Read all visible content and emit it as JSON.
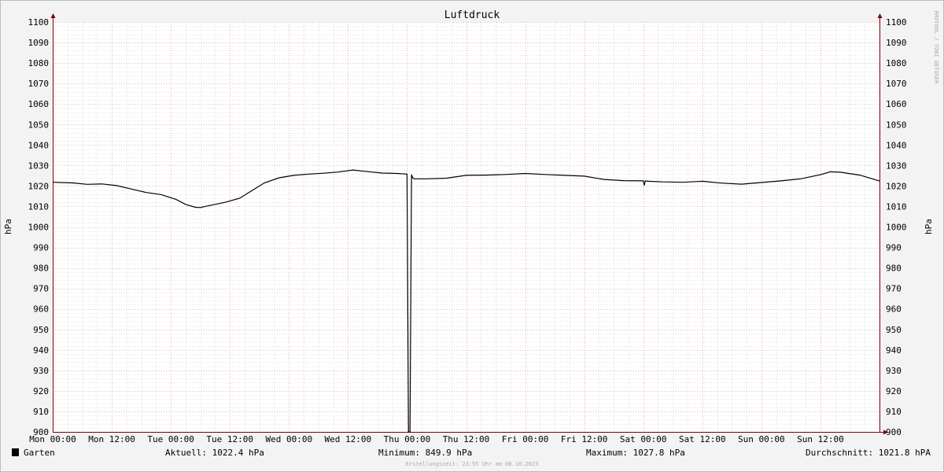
{
  "chart_data": {
    "type": "line",
    "title": "Luftdruck",
    "ylabel": "hPa",
    "ylabel_right": "hPa",
    "ylim": [
      900,
      1100
    ],
    "yticks": [
      900,
      910,
      920,
      930,
      940,
      950,
      960,
      970,
      980,
      990,
      1000,
      1010,
      1020,
      1030,
      1040,
      1050,
      1060,
      1070,
      1080,
      1090,
      1100
    ],
    "xlim_hours": [
      0,
      168
    ],
    "xticks": [
      {
        "hour": 0,
        "label": "Mon 00:00"
      },
      {
        "hour": 12,
        "label": "Mon 12:00"
      },
      {
        "hour": 24,
        "label": "Tue 00:00"
      },
      {
        "hour": 36,
        "label": "Tue 12:00"
      },
      {
        "hour": 48,
        "label": "Wed 00:00"
      },
      {
        "hour": 60,
        "label": "Wed 12:00"
      },
      {
        "hour": 72,
        "label": "Thu 00:00"
      },
      {
        "hour": 84,
        "label": "Thu 12:00"
      },
      {
        "hour": 96,
        "label": "Fri 00:00"
      },
      {
        "hour": 108,
        "label": "Fri 12:00"
      },
      {
        "hour": 120,
        "label": "Sat 00:00"
      },
      {
        "hour": 132,
        "label": "Sat 12:00"
      },
      {
        "hour": 144,
        "label": "Sun 00:00"
      },
      {
        "hour": 156,
        "label": "Sun 12:00"
      }
    ],
    "series": [
      {
        "name": "Garten",
        "color": "#000000",
        "hours": [
          0,
          4,
          7,
          10,
          13,
          16,
          19,
          22,
          25,
          27,
          29,
          30,
          32,
          35,
          38,
          41,
          43,
          46,
          49,
          52,
          55,
          58,
          61,
          64,
          67,
          70,
          72,
          72.3,
          72.6,
          72.9,
          73.2,
          73.5,
          76,
          80,
          84,
          88,
          92,
          96,
          100,
          104,
          108,
          112,
          116,
          120,
          120.2,
          120.4,
          120.6,
          121,
          124,
          128,
          132,
          136,
          140,
          144,
          148,
          152,
          156,
          158,
          160,
          164,
          168
        ],
        "values": [
          1021.8,
          1021.5,
          1020.8,
          1021,
          1020.2,
          1018.5,
          1016.8,
          1015.8,
          1013.5,
          1011,
          1009.6,
          1009.5,
          1010.5,
          1012,
          1014,
          1018.5,
          1021.5,
          1024,
          1025.2,
          1025.8,
          1026.2,
          1026.8,
          1027.8,
          1027,
          1026.3,
          1026.1,
          1025.8,
          849.9,
          849.9,
          1025.5,
          1023.8,
          1023.5,
          1023.5,
          1023.8,
          1025.2,
          1025.3,
          1025.6,
          1026.1,
          1025.6,
          1025.2,
          1024.8,
          1023.2,
          1022.6,
          1022.5,
          1020.3,
          1022.5,
          1022.4,
          1022.3,
          1022.0,
          1021.8,
          1022.3,
          1021.4,
          1020.9,
          1021.7,
          1022.5,
          1023.5,
          1025.5,
          1026.9,
          1026.7,
          1025.3,
          1022.4
        ]
      }
    ],
    "legend": "bottom-left",
    "grid": true
  },
  "watermark": "RRDTOOL / TOBI OETIKER",
  "legend": {
    "series_name": "Garten",
    "aktuell": "Aktuell: 1022.4 hPa",
    "minimum": "Minimum: 849.9 hPa",
    "maximum": "Maximum: 1027.8 hPa",
    "durchschnitt": "Durchschnitt: 1021.8 hPA"
  },
  "footer": "Erstellungszeit: 23:55 Uhr am 08.10.2023",
  "colors": {
    "background": "#f3f3f3",
    "canvas": "#ffffff",
    "major_grid": "#e9a0a0",
    "minor_grid": "#c8c8c8",
    "axis": "#7a0000",
    "line": "#000000"
  }
}
